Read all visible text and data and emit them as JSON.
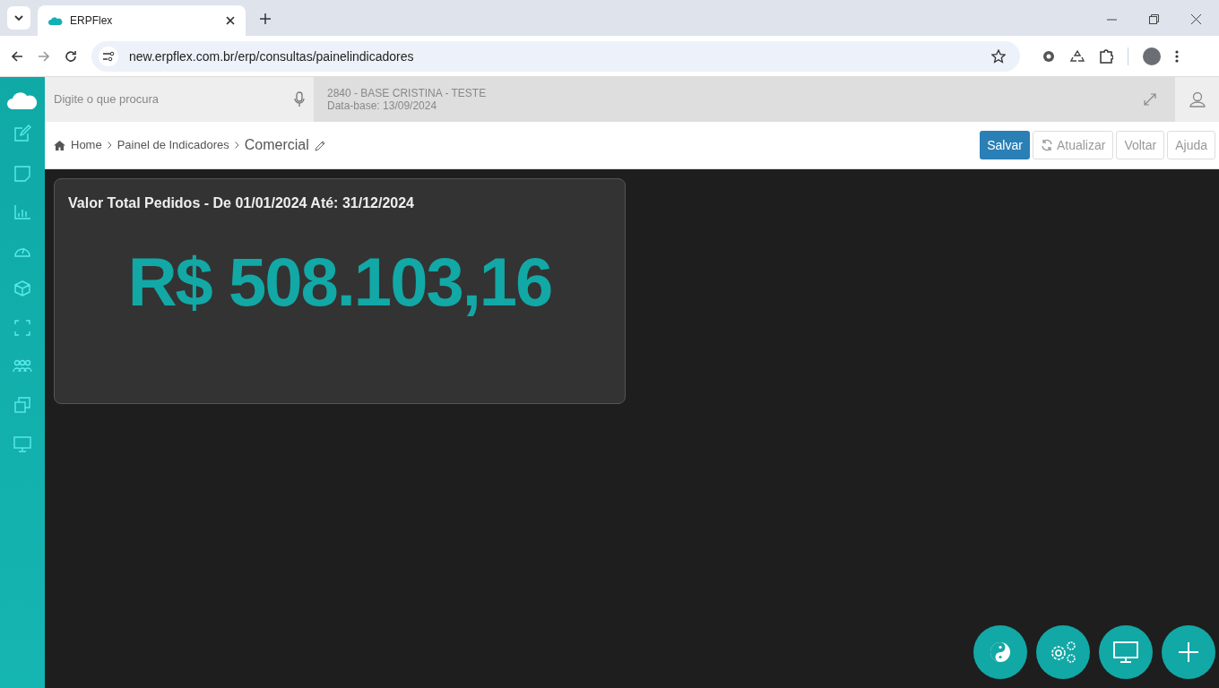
{
  "browser": {
    "tab_title": "ERPFlex",
    "url": "new.erpflex.com.br/erp/consultas/painelindicadores"
  },
  "header": {
    "search_placeholder": "Digite o que procura",
    "company": "2840 - BASE CRISTINA - TESTE",
    "database_date": "Data-base: 13/09/2024"
  },
  "breadcrumb": [
    "Home",
    "Painel de Indicadores"
  ],
  "page_title": "Comercial",
  "actions": [
    {
      "label": "Salvar",
      "kind": "primary"
    },
    {
      "label": "Atualizar",
      "kind": "refresh"
    },
    {
      "label": "Voltar",
      "kind": "plain"
    },
    {
      "label": "Ajuda",
      "kind": "plain"
    }
  ],
  "cards": [
    {
      "title": "Valor Total Pedidos - De 01/01/2024 Até: 31/12/2024",
      "value": "R$ 508.103,16"
    }
  ]
}
